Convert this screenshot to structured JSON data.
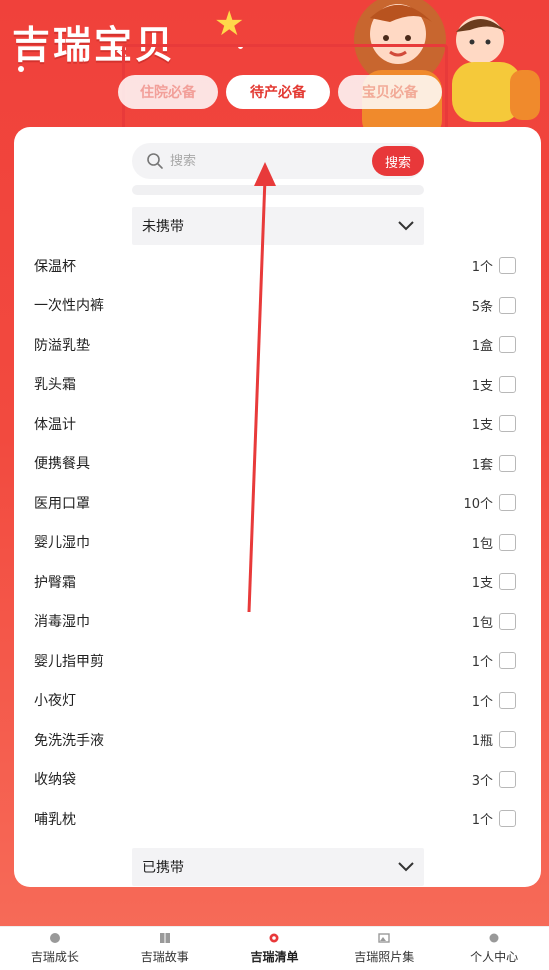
{
  "app": {
    "brand": "吉瑞宝贝"
  },
  "tabs": [
    {
      "label": "住院必备"
    },
    {
      "label": "待产必备"
    },
    {
      "label": "宝贝必备"
    }
  ],
  "search": {
    "placeholder": "搜索",
    "button": "搜索"
  },
  "groups": {
    "uncarried": "未携带",
    "carried": "已携带"
  },
  "items": [
    {
      "name": "保温杯",
      "qty": "1个"
    },
    {
      "name": "一次性内裤",
      "qty": "5条"
    },
    {
      "name": "防溢乳垫",
      "qty": "1盒"
    },
    {
      "name": "乳头霜",
      "qty": "1支"
    },
    {
      "name": "体温计",
      "qty": "1支"
    },
    {
      "name": "便携餐具",
      "qty": "1套"
    },
    {
      "name": "医用口罩",
      "qty": "10个"
    },
    {
      "name": "婴儿湿巾",
      "qty": "1包"
    },
    {
      "name": "护臀霜",
      "qty": "1支"
    },
    {
      "name": "消毒湿巾",
      "qty": "1包"
    },
    {
      "name": "婴儿指甲剪",
      "qty": "1个"
    },
    {
      "name": "小夜灯",
      "qty": "1个"
    },
    {
      "name": "免洗洗手液",
      "qty": "1瓶"
    },
    {
      "name": "收纳袋",
      "qty": "3个"
    },
    {
      "name": "哺乳枕",
      "qty": "1个"
    }
  ],
  "tabbar": [
    {
      "label": "吉瑞成长",
      "icon": "growth-icon"
    },
    {
      "label": "吉瑞故事",
      "icon": "book-icon"
    },
    {
      "label": "吉瑞清单",
      "icon": "list-gear-icon",
      "active": true
    },
    {
      "label": "吉瑞照片集",
      "icon": "photo-icon"
    },
    {
      "label": "个人中心",
      "icon": "user-icon"
    }
  ],
  "colors": {
    "primary": "#e8383a",
    "arrow": "#e83a3a"
  }
}
